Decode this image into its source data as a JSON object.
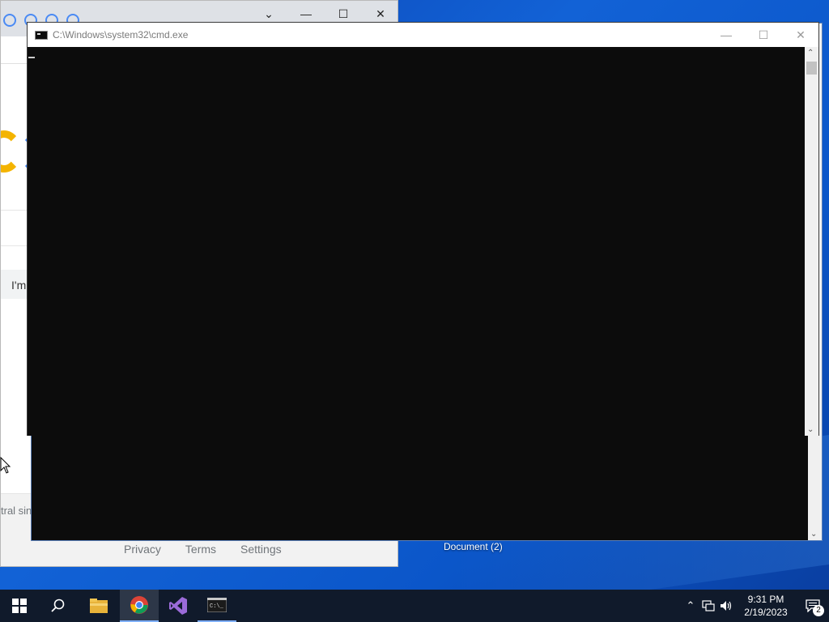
{
  "browser": {
    "lucky_text": "I'm",
    "footer_left": "tral sin",
    "footer_links": [
      "Privacy",
      "Terms",
      "Settings"
    ],
    "window_buttons": [
      "chevron-down",
      "minimize",
      "maximize",
      "close"
    ]
  },
  "cmd": {
    "title": "C:\\Windows\\system32\\cmd.exe"
  },
  "desktop": {
    "icon_label": "Document (2)"
  },
  "taskbar": {
    "items": [
      "start",
      "search",
      "file-explorer",
      "chrome",
      "visual-studio",
      "cmd"
    ],
    "clock_time": "9:31 PM",
    "clock_date": "2/19/2023",
    "notification_count": "2"
  },
  "colors": {
    "taskbar": "#101a2b",
    "console_bg": "#0c0c0c",
    "accent": "#7fb0ff"
  }
}
